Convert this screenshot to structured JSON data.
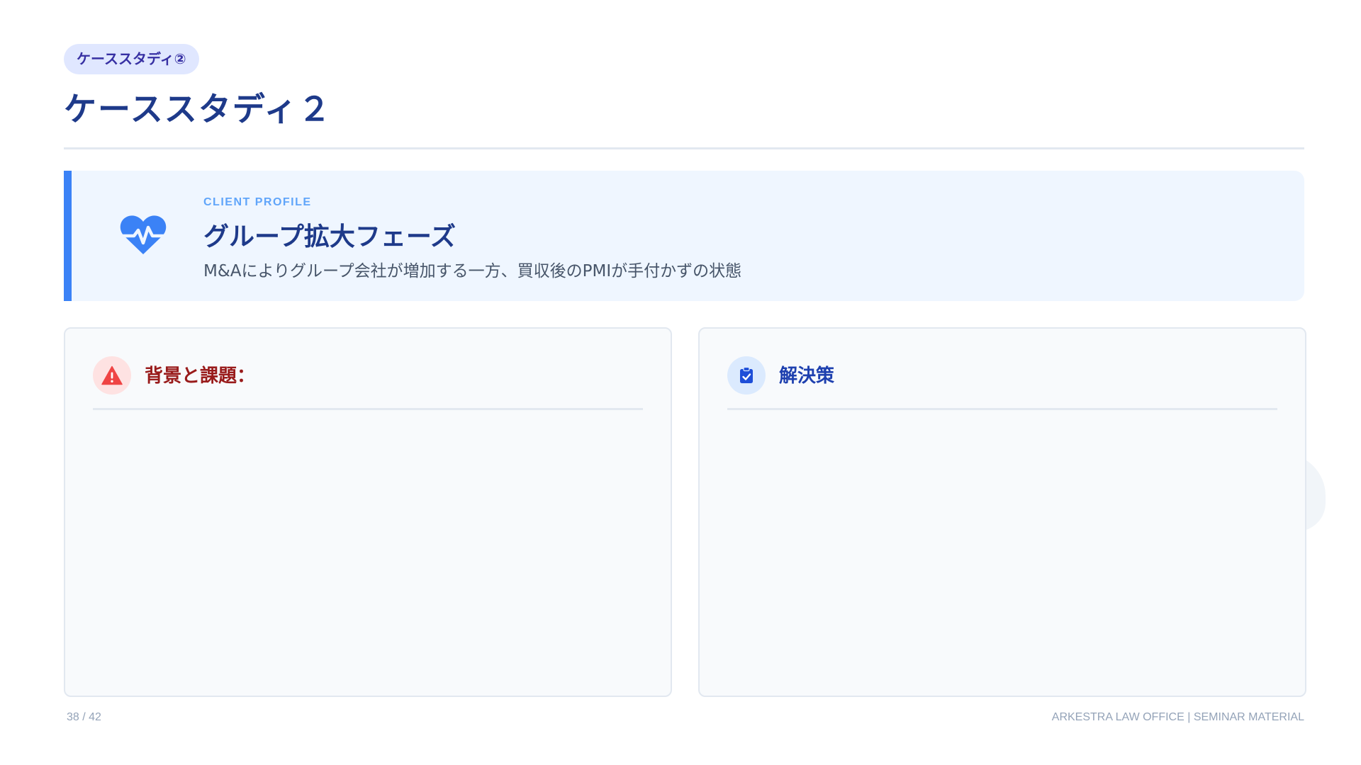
{
  "header": {
    "badge": "ケーススタディ②",
    "title": "ケーススタディ２"
  },
  "profile": {
    "icon": "heartbeat-icon",
    "label": "CLIENT PROFILE",
    "title": "グループ拡大フェーズ",
    "description": "M&Aによりグループ会社が増加する一方、買収後のPMIが手付かずの状態"
  },
  "panels": {
    "challenges": {
      "icon": "warning-icon",
      "title": "背景と課題："
    },
    "solutions": {
      "icon": "clipboard-check-icon",
      "title": "解決策"
    }
  },
  "footer": {
    "page": "38 / 42",
    "org": "ARKESTRA LAW OFFICE | SEMINAR MATERIAL"
  },
  "colors": {
    "primary": "#1e3a8a",
    "accent": "#3b82f6",
    "danger": "#ef4444",
    "danger_text": "#991b1b",
    "badge_bg": "#e0e7ff",
    "profile_bg": "#eff6ff"
  }
}
